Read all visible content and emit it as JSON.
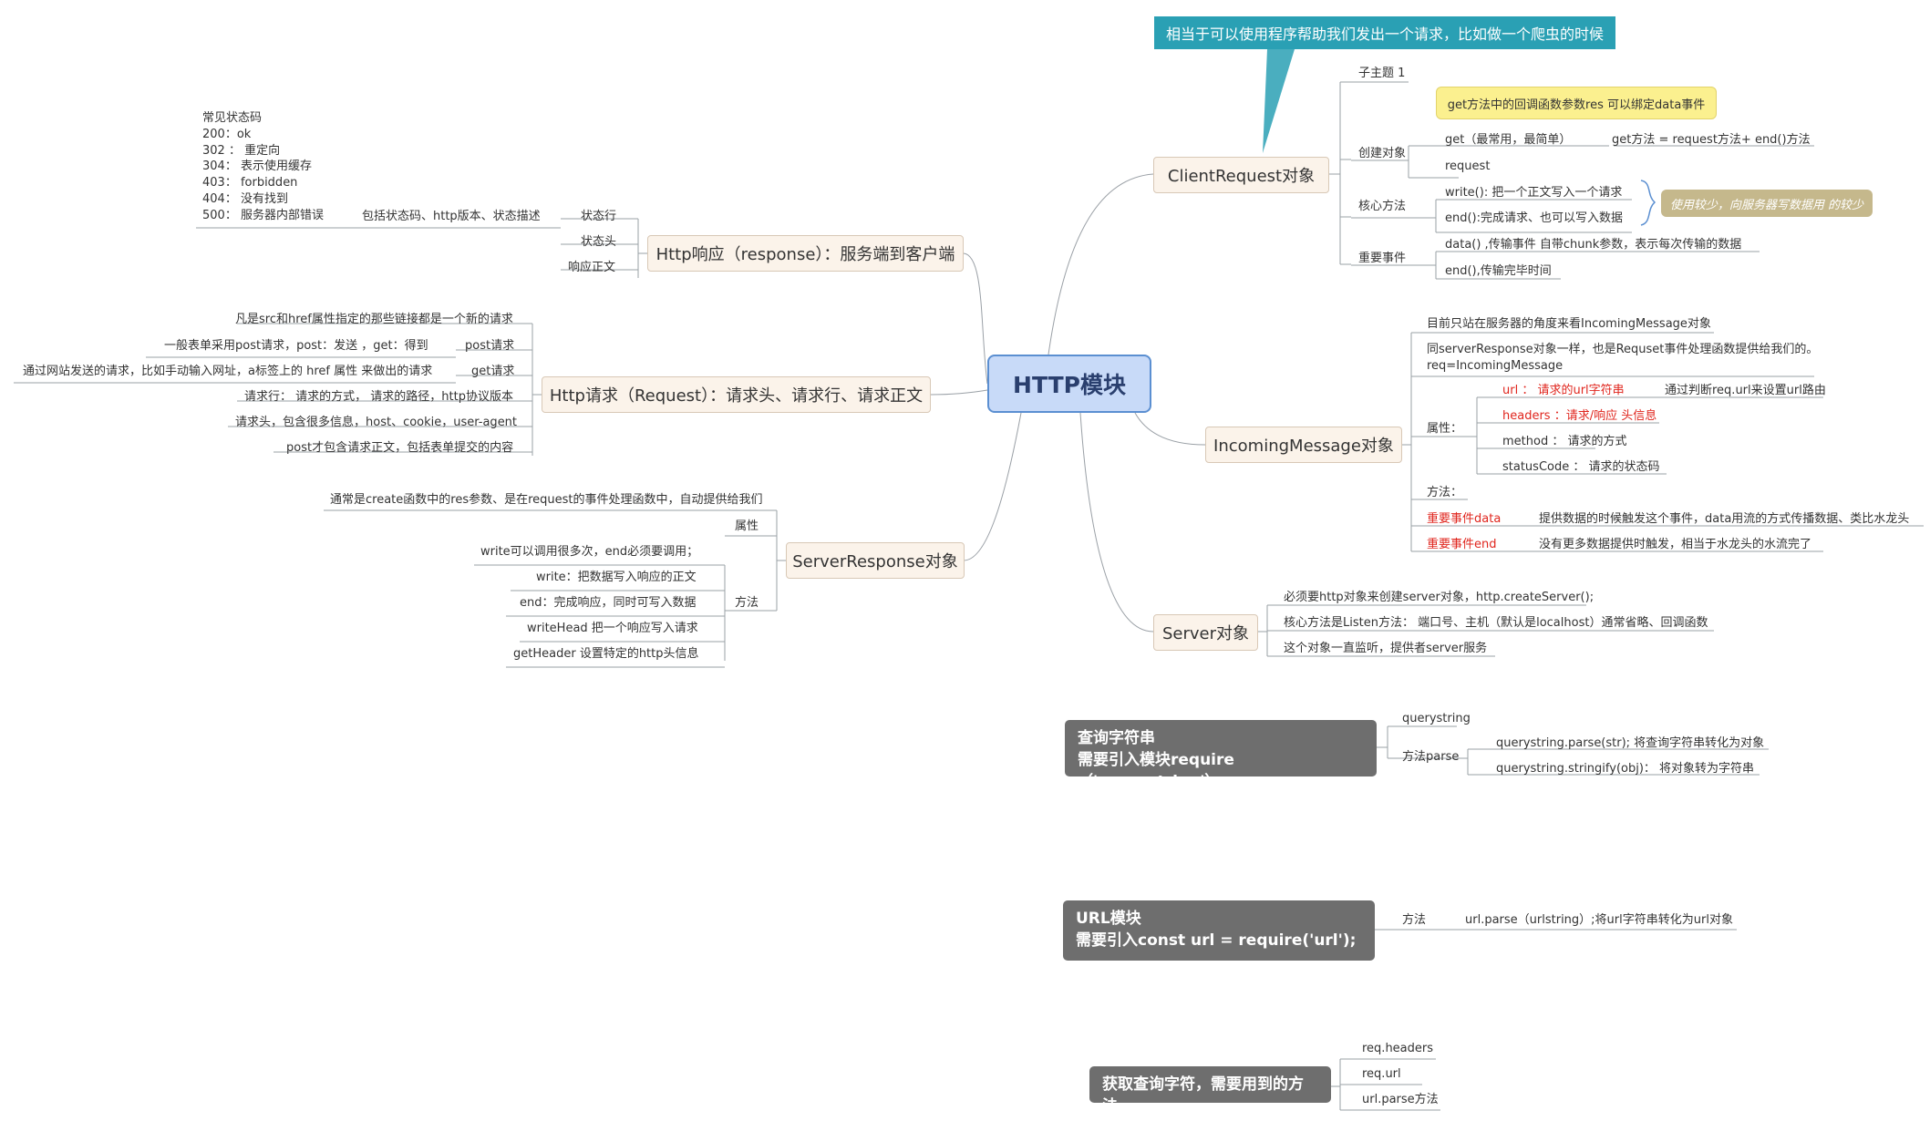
{
  "root": "HTTP模块",
  "callout": "相当于可以使用程序帮助我们发出一个请求，比如做一个爬虫的时候",
  "client_request": {
    "title": "ClientRequest对象",
    "subtopic": "子主题 1",
    "create_label": "创建对象",
    "note": "get方法中的回调函数参数res 可以绑定data事件",
    "get": "get（最常用，最简单）",
    "get_method": "get方法 = request方法+ end()方法",
    "request": "request",
    "core_label": "核心方法",
    "write": "write(): 把一个正文写入一个请求",
    "end": "end():完成请求、也可以写入数据",
    "summary": "使用较少，向服务器写数据用 的较少",
    "events_label": "重要事件",
    "data_event": "data() ,传输事件  自带chunk参数，表示每次传输的数据",
    "end_event": "end(),传输完毕时间"
  },
  "incoming": {
    "title": "IncomingMessage对象",
    "line1": "目前只站在服务器的角度来看IncomingMessage对象",
    "line2a": "同serverResponse对象一样，也是Requset事件处理函数提供给我们的。",
    "line2b": "req=IncomingMessage",
    "props_label": "属性：",
    "url": "url ： 请求的url字符串",
    "url_note": "通过判断req.url来设置url路由",
    "headers": "headers ：请求/响应 头信息",
    "method": "method ： 请求的方式",
    "status_code": "statusCode ： 请求的状态码",
    "methods_label": "方法：",
    "data_event": "重要事件data",
    "data_note": "提供数据的时候触发这个事件，data用流的方式传播数据、类比水龙头",
    "end_event": "重要事件end",
    "end_note": "没有更多数据提供时触发，相当于水龙头的水流完了"
  },
  "server": {
    "title": "Server对象",
    "line1": "必须要http对象来创建server对象，http.createServer();",
    "line2": "核心方法是Listen方法： 端口号、主机（默认是localhost）通常省略、回调函数",
    "line3": "这个对象一直监听，提供者server服务"
  },
  "response": {
    "title": "Http响应（response）：服务端到客户端",
    "status_list": [
      "常见状态码",
      "200：ok",
      "302 ： 重定向",
      "304： 表示使用缓存",
      "403： forbidden",
      "404： 没有找到",
      "500： 服务器内部错误"
    ],
    "status_line_desc": "包括状态码、http版本、状态描述",
    "status_line": "状态行",
    "header": "状态头",
    "body": "响应正文"
  },
  "request": {
    "title": "Http请求（Request）：请求头、请求行、请求正文",
    "src_href": "凡是src和href属性指定的那些链接都是一个新的请求",
    "form_desc": "一般表单采用post请求，post：发送 ，get：得到",
    "post_req": "post请求",
    "addr_desc": "通过网站发送的请求，比如手动输入网址，a标签上的 href 属性 来做出的请求",
    "get_req": "get请求",
    "line": "请求行： 请求的方式， 请求的路径，http协议版本",
    "header": "请求头，包含很多信息，host、cookie，user-agent",
    "body": "post才包含请求正文，包括表单提交的内容"
  },
  "server_response": {
    "title": "ServerResponse对象",
    "desc": "通常是create函数中的res参数、是在request的事件处理函数中，自动提供给我们",
    "props_label": "属性",
    "methods_label": "方法",
    "write_multi": "write可以调用很多次，end必须要调用；",
    "write": "write：把数据写入响应的正文",
    "end": "end：完成响应，同时可写入数据",
    "write_head": "writeHead 把一个响应写入请求",
    "get_header": "getHeader 设置特定的http头信息"
  },
  "querystring": {
    "title1": "查询字符串",
    "title2": "需要引入模块require（'querystring'）;",
    "name": "querystring",
    "parse_label": "方法parse",
    "parse": "querystring.parse(str); 将查询字符串转化为对象",
    "stringify": "querystring.stringify(obj)： 将对象转为字符串"
  },
  "url_module": {
    "title1": "URL模块",
    "title2": "需要引入const url = require('url');",
    "method_label": "方法",
    "parse": "url.parse（urlstring）;将url字符串转化为url对象"
  },
  "get_query": {
    "title": "获取查询字符，需要用到的方法",
    "items": [
      "req.headers",
      "req.url",
      "url.parse方法"
    ]
  },
  "colors": {
    "root_fill": "#c8daf8",
    "main_fill": "#fbf3ea",
    "callout": "#2aa0b4",
    "note": "#fbf08f",
    "summary": "#c5b88c",
    "dark_topic": "#6e6e6e",
    "red_text": "#e0261e"
  }
}
